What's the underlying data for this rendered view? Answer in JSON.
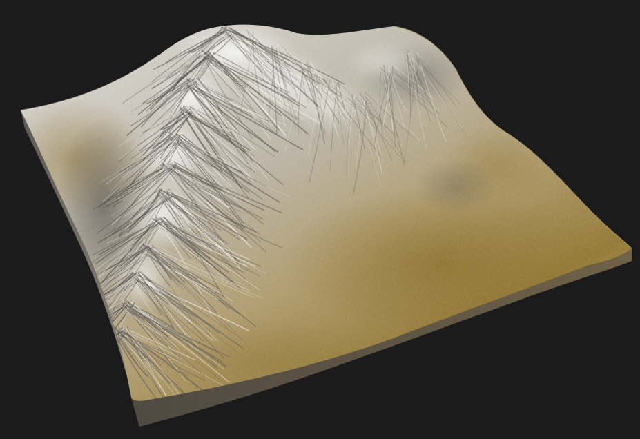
{
  "scene": {
    "subject": "terrain-heightmap-render",
    "style": "shaded-3d-relief",
    "colors": {
      "background": "#1b1b1b",
      "snow": "#f2f2f0",
      "rock_light": "#d9d6cf",
      "rock_mid": "#a8a49a",
      "rock_dark": "#4e4b45",
      "sediment_light": "#c9b487",
      "sediment_mid": "#a98d54",
      "sediment_dark": "#7a6228",
      "edge_face": "#6f6453",
      "edge_face_dark": "#3e372c"
    }
  }
}
